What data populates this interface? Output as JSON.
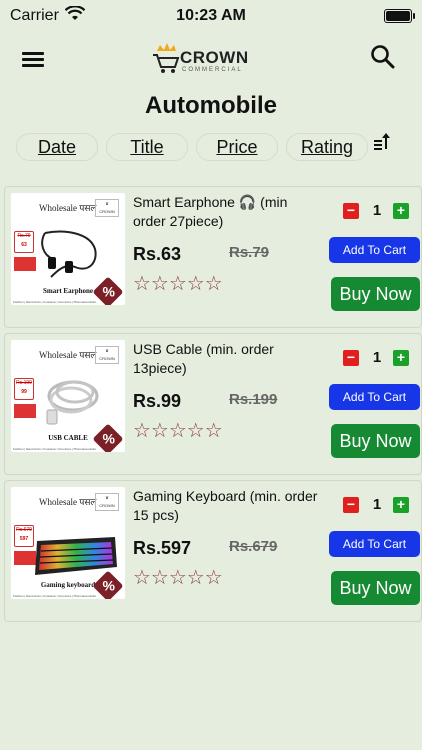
{
  "status_bar": {
    "carrier": "Carrier",
    "time": "10:23 AM"
  },
  "header": {
    "logo_brand": "CROWN",
    "logo_sub": "COMMERCIAL",
    "menu_icon": "hamburger-icon",
    "search_icon": "search-icon"
  },
  "page_title": "Automobile",
  "sort": {
    "options": [
      "Date",
      "Title",
      "Price",
      "Rating"
    ],
    "sort_icon": "sort-ascending-icon"
  },
  "products": [
    {
      "name": "Smart Earphone 🎧 (min order 27piece)",
      "price": "Rs.63",
      "mrp": "Rs.79",
      "rating": "☆☆☆☆☆",
      "qty": "1",
      "thumb_title": "Wholesale पसल",
      "thumb_label": "Smart Earphone",
      "thumb_mrp": "Rs.79",
      "thumb_price": "63",
      "thumb_footer": "Fashion | Electronics | Footwear | Groceries | Pharmaceuticals"
    },
    {
      "name": "USB Cable (min. order 13piece)",
      "price": "Rs.99",
      "mrp": "Rs.199",
      "rating": "☆☆☆☆☆",
      "qty": "1",
      "thumb_title": "Wholesale पसल",
      "thumb_label": "USB CABLE",
      "thumb_mrp": "Rs.199",
      "thumb_price": "99",
      "thumb_footer": "Fashion | Electronics | Footwear | Groceries | Pharmaceuticals"
    },
    {
      "name": "Gaming Keyboard (min. order 15 pcs)",
      "price": "Rs.597",
      "mrp": "Rs.679",
      "rating": "☆☆☆☆☆",
      "qty": "1",
      "thumb_title": "Wholesale पसल",
      "thumb_label": "Gaming keyboard",
      "thumb_mrp": "Rs.679",
      "thumb_price": "597",
      "thumb_footer": "Fashion | Electronics | Footwear | Groceries | Pharmaceuticals"
    }
  ],
  "buttons": {
    "add_to_cart": "Add To Cart",
    "buy_now": "Buy Now",
    "minus": "−",
    "plus": "+"
  },
  "colors": {
    "background": "#e5eddf",
    "add_to_cart": "#1736e8",
    "buy_now": "#168a33",
    "minus": "#e01f1f",
    "plus": "#1aa12a",
    "badge": "#7a2026"
  }
}
